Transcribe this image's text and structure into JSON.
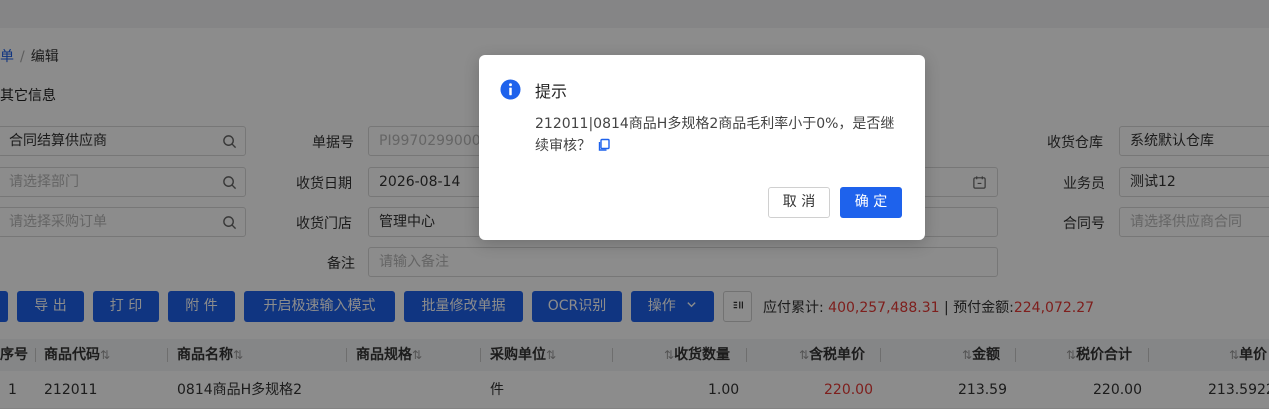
{
  "breadcrumb": {
    "parent": "单",
    "separator": "/",
    "current": "编辑"
  },
  "section_title": "其它信息",
  "form": {
    "supplier": {
      "value": "合同结算供应商"
    },
    "department": {
      "placeholder": "请选择部门"
    },
    "purchase_order": {
      "placeholder": "请选择采购订单"
    },
    "doc_no": {
      "label": "单据号",
      "value": "PI99702990001"
    },
    "receive_date": {
      "label": "收货日期",
      "value": "2026-08-14"
    },
    "receive_store": {
      "label": "收货门店",
      "value": "管理中心"
    },
    "remark": {
      "label": "备注",
      "placeholder": "请输入备注"
    },
    "warehouse": {
      "label": "收货仓库",
      "value": "系统默认仓库"
    },
    "salesman": {
      "label": "业务员",
      "value": "测试12"
    },
    "contract_no": {
      "label": "合同号",
      "placeholder": "请选择供应商合同"
    }
  },
  "toolbar": {
    "export": "导 出",
    "print": "打 印",
    "attach": "附 件",
    "quick_input": "开启极速输入模式",
    "batch_edit": "批量修改单据",
    "ocr": "OCR识别",
    "operate": "操作"
  },
  "summary": {
    "payable_label": "应付累计:",
    "payable_value": "400,257,488.31",
    "divider": "|",
    "prepaid_label": "预付金额:",
    "prepaid_value": "224,072.27"
  },
  "table": {
    "headers": {
      "seq": "序号",
      "code": "商品代码",
      "name": "商品名称",
      "spec": "商品规格",
      "unit": "采购单位",
      "qty": "收货数量",
      "tax_price": "含税单价",
      "amount": "金额",
      "tax_total": "税价合计",
      "price": "单价"
    },
    "rows": [
      {
        "seq": "1",
        "code": "212011",
        "name": "0814商品H多规格2",
        "unit": "件",
        "qty": "1.00",
        "tax_price": "220.00",
        "amount": "213.59",
        "tax_total": "220.00",
        "price": "213.5922"
      }
    ]
  },
  "dialog": {
    "title": "提示",
    "message": "212011|0814商品H多规格2商品毛利率小于0%，是否继续审核？",
    "cancel": "取 消",
    "confirm": "确 定"
  },
  "colors": {
    "primary": "#1e62ec",
    "danger": "#e53935",
    "overlay": "rgba(0,0,0,0.45)"
  }
}
